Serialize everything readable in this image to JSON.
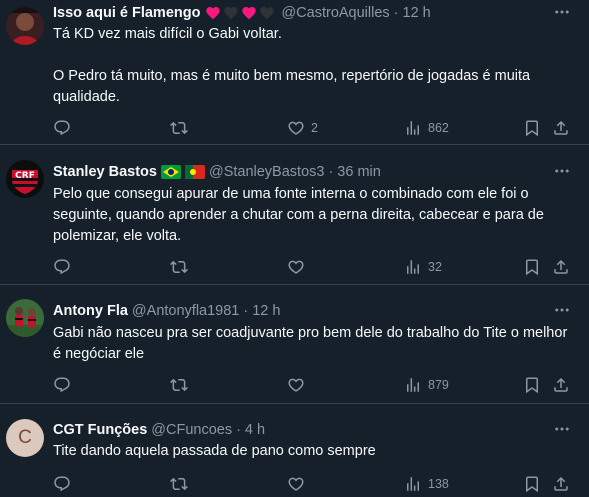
{
  "tweets": [
    {
      "name": "Isso aqui é Flamengo",
      "handle": "@CastroAquilles",
      "time": "12 h",
      "body": [
        "Tá KD vez mais difícil o Gabi voltar.",
        "",
        "O Pedro tá muito, mas é muito bem mesmo, repertório de jogadas é muita qualidade."
      ],
      "likes": "2",
      "views": "862"
    },
    {
      "name": "Stanley Bastos",
      "handle": "@StanleyBastos3",
      "time": "36 min",
      "body": [
        "Pelo que consegui apurar de uma fonte interna o combinado com ele foi o seguinte, quando aprender a chutar com a perna direita, cabecear e para de polemizar, ele volta."
      ],
      "likes": "",
      "views": "32"
    },
    {
      "name": "Antony Fla",
      "handle": "@Antonyfla1981",
      "time": "12 h",
      "body": [
        "Gabi não nasceu pra ser coadjuvante pro bem dele do trabalho do Tite o melhor é negóciar ele"
      ],
      "likes": "",
      "views": "879"
    },
    {
      "name": "CGT Funções",
      "handle": "@CFuncoes",
      "time": "4 h",
      "avatar_letter": "C",
      "body": [
        "Tite dando aquela passada de pano como sempre"
      ],
      "likes": "",
      "views": "138"
    }
  ],
  "separator": "·",
  "colors": {
    "background": "#15202b",
    "text": "#f7f9f9",
    "muted": "#8b98a5",
    "border": "#38444d",
    "heart_red": "#f91880",
    "heart_dark": "#2f3336"
  }
}
